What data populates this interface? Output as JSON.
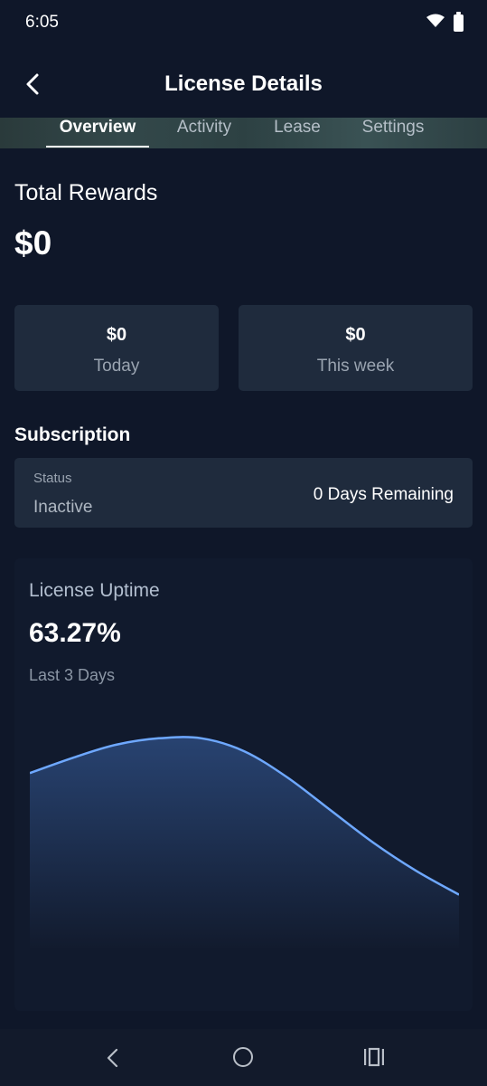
{
  "status_bar": {
    "time": "6:05"
  },
  "header": {
    "title": "License Details"
  },
  "tabs": [
    {
      "label": "Overview",
      "active": true
    },
    {
      "label": "Activity",
      "active": false
    },
    {
      "label": "Lease",
      "active": false
    },
    {
      "label": "Settings",
      "active": false
    }
  ],
  "rewards": {
    "total_label": "Total Rewards",
    "total_value": "$0",
    "today": {
      "value": "$0",
      "label": "Today"
    },
    "week": {
      "value": "$0",
      "label": "This week"
    }
  },
  "subscription": {
    "heading": "Subscription",
    "status_label": "Status",
    "status_value": "Inactive",
    "remaining": "0 Days Remaining"
  },
  "uptime": {
    "title": "License Uptime",
    "value": "63.27%",
    "period": "Last 3 Days"
  },
  "chart_data": {
    "type": "area",
    "x": [
      0,
      1,
      2,
      3,
      4,
      5,
      6,
      7,
      8,
      9,
      10
    ],
    "values": [
      0.72,
      0.79,
      0.85,
      0.88,
      0.88,
      0.82,
      0.7,
      0.55,
      0.4,
      0.27,
      0.16
    ],
    "ylim": [
      0,
      1
    ],
    "grid": false,
    "line_color": "#6ea8ff",
    "fill_top_color": "#284371",
    "fill_bottom_color": "#121b2e"
  },
  "nav": {
    "back_icon": "nav-back-icon",
    "home_icon": "nav-home-icon",
    "recent_icon": "nav-recents-icon"
  },
  "colors": {
    "background": "#0f1729",
    "card": "#1f2b3d",
    "accent_line": "#6ea8ff"
  }
}
